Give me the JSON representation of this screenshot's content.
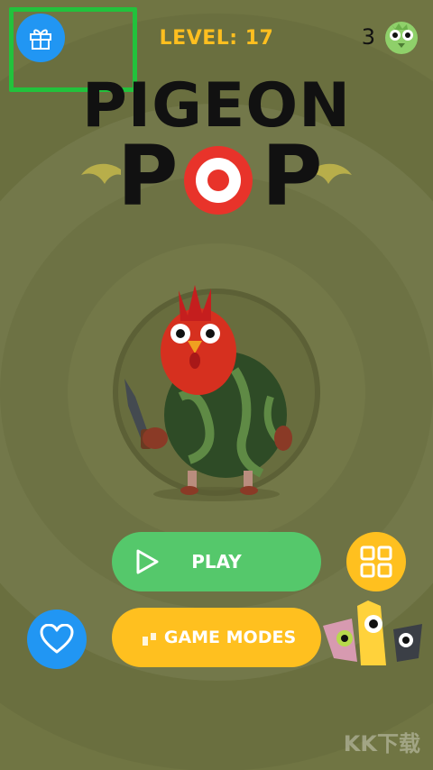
{
  "header": {
    "level_text": "LEVEL: 17",
    "coin_count": "3"
  },
  "logo": {
    "line1": "PIGEON",
    "line2_left": "P",
    "line2_right": "P"
  },
  "buttons": {
    "play_label": "PLAY",
    "game_modes_label": "GAME MODES"
  },
  "icons": {
    "gift": "gift-icon",
    "coin_mascot": "green-bird-icon",
    "play": "play-icon",
    "grid": "grid-icon",
    "heart": "heart-icon",
    "birds_group": "bird-characters-icon"
  },
  "watermark": "KK下载",
  "colors": {
    "background": "#6f7442",
    "accent_yellow": "#ffc01f",
    "play_green": "#55c86b",
    "blue": "#2196f3",
    "logo_red": "#e8332a",
    "highlight_green": "#22c23c"
  }
}
